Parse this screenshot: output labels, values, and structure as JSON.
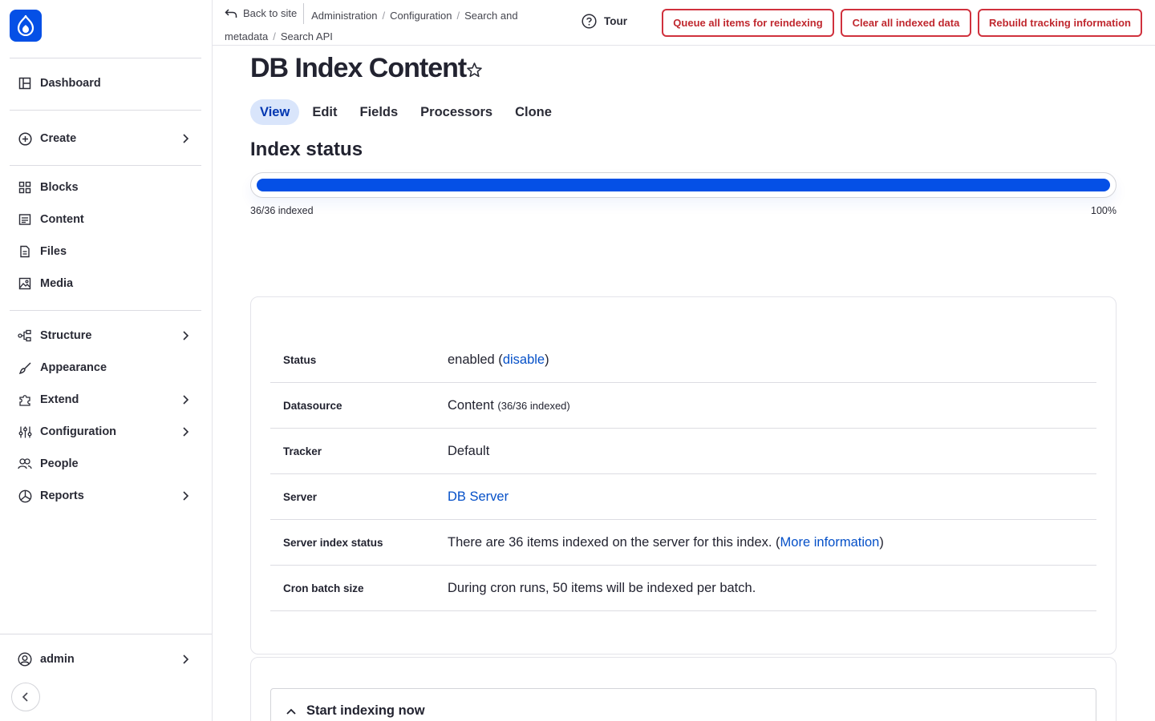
{
  "sidebar": {
    "items": [
      {
        "label": "Dashboard",
        "icon": "dashboard-icon"
      },
      {
        "label": "Create",
        "icon": "plus-circle-icon"
      },
      {
        "label": "Blocks",
        "icon": "blocks-icon"
      },
      {
        "label": "Content",
        "icon": "content-icon"
      },
      {
        "label": "Files",
        "icon": "files-icon"
      },
      {
        "label": "Media",
        "icon": "media-icon"
      },
      {
        "label": "Structure",
        "icon": "structure-icon"
      },
      {
        "label": "Appearance",
        "icon": "brush-icon"
      },
      {
        "label": "Extend",
        "icon": "puzzle-icon"
      },
      {
        "label": "Configuration",
        "icon": "sliders-icon"
      },
      {
        "label": "People",
        "icon": "people-icon"
      },
      {
        "label": "Reports",
        "icon": "reports-icon"
      }
    ],
    "user": {
      "label": "admin",
      "icon": "user-circle-icon"
    }
  },
  "header": {
    "back_label": "Back to site",
    "breadcrumb": [
      "Administration",
      "Configuration",
      "Search and metadata",
      "Search API"
    ],
    "tour_label": "Tour",
    "actions": [
      {
        "label": "Queue all items for reindexing"
      },
      {
        "label": "Clear all indexed data"
      },
      {
        "label": "Rebuild tracking information"
      }
    ]
  },
  "main": {
    "title": "DB Index Content",
    "tabs": [
      {
        "label": "View",
        "active": true
      },
      {
        "label": "Edit"
      },
      {
        "label": "Fields"
      },
      {
        "label": "Processors"
      },
      {
        "label": "Clone"
      }
    ],
    "index_status_title": "Index status",
    "progress": {
      "fraction": 1.0,
      "label": "36/36 indexed",
      "percent_label": "100%"
    },
    "info": {
      "status": {
        "label": "Status",
        "prefix": "enabled (",
        "link": "disable",
        "suffix": ")"
      },
      "datasource": {
        "label": "Datasource",
        "value": "Content",
        "detail": "(36/36 indexed)"
      },
      "tracker": {
        "label": "Tracker",
        "value": "Default"
      },
      "server": {
        "label": "Server",
        "link": "DB Server"
      },
      "server_index_status": {
        "label": "Server index status",
        "prefix": "There are 36 items indexed on the server for this index. (",
        "link": "More information",
        "suffix": ")"
      },
      "cron_batch_size": {
        "label": "Cron batch size",
        "value": "During cron runs, 50 items will be indexed per batch."
      }
    },
    "start_indexing_label": "Start indexing now"
  },
  "colors": {
    "accent": "#0550e6",
    "danger": "#d0313d",
    "active_tab_bg": "#d9e5fb"
  }
}
